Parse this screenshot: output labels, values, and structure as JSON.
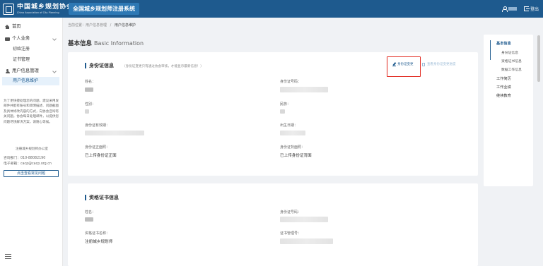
{
  "header": {
    "logo_cn": "中国城乡规划协会",
    "logo_en": "China Association of City Planning",
    "system_title": "全国城乡规划师注册系统",
    "logout_label": "登出"
  },
  "sidebar": {
    "home": "首页",
    "personal_business": "个人业务",
    "initial_registration": "初始注册",
    "certificate_management": "证书管理",
    "user_info_management": "用户信息管理",
    "user_info_maintenance": "用户信息维护",
    "notice_text": "为了更快捷处理您的问题，建议采用发邮件并配有账号和简明描述、问题截图及具体修改内容的方式，向协会咨询有关问题。协会每日处理邮件，以提供您问题尽快解决方案，请耐心等候。",
    "org_name": "注册城乡规划师办公室",
    "consult_phone": "咨询部门：010-88082190",
    "email": "电子邮箱：cacp@cacp.org.cn",
    "faq_button": "点击查看常见问题"
  },
  "breadcrumb": {
    "prefix": "当前位置：用户信息管理",
    "separator": "/",
    "current": "用户信息维护"
  },
  "page": {
    "title": "基本信息",
    "title_en": "Basic Information"
  },
  "identity": {
    "section_title": "身份证信息",
    "note": "（身份证变更只有通过协会审核，才能显示最新信息！）",
    "change_button": "身份证变更",
    "progress_button": "查看身份证变更进度",
    "name_label": "姓名：",
    "id_number_label": "身份证号码：",
    "gender_label": "性别：",
    "ethnicity_label": "民族：",
    "valid_period_label": "身份证有效期：",
    "birth_date_label": "出生日期：",
    "id_front_label": "身份证正面照：",
    "id_front_value": "已上传身份证正面",
    "id_back_label": "身份证背面照：",
    "id_back_value": "已上传身份证背面"
  },
  "qualification": {
    "section_title": "资格证书信息",
    "name_label": "姓名：",
    "id_number_label": "身份证号码：",
    "cert_name_label": "资格证书名称：",
    "cert_name_value": "注册城乡规划师",
    "cert_number_label": "证书管理号："
  },
  "anchor_nav": {
    "basic_info": "基本信息",
    "identity_info": "身份证信息",
    "qualification_info": "资格证书信息",
    "current_work": "数据工作信息",
    "work_experience": "工作简历",
    "work_performance": "工作业绩",
    "continuing_education": "继续教育"
  },
  "colors": {
    "header_bg": "#1e5a8e",
    "accent": "#1e5a8e",
    "highlight_box": "#e1251b"
  }
}
